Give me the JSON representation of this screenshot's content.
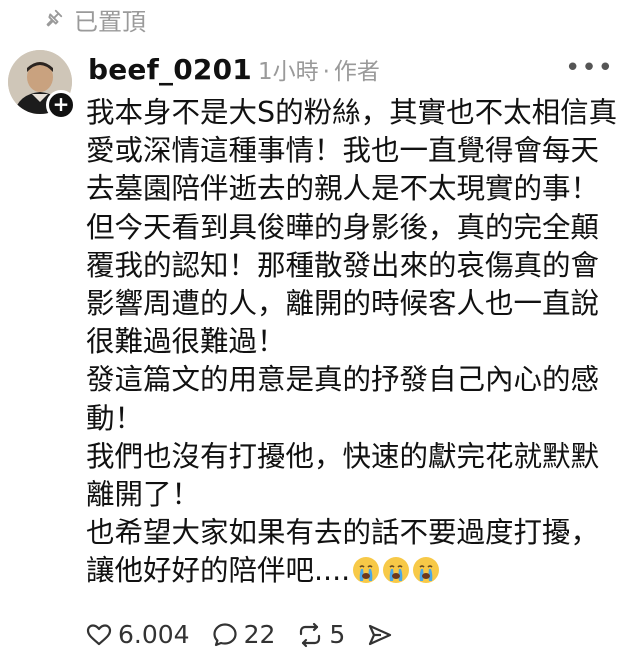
{
  "pinned": {
    "label": "已置頂",
    "icon": "pin-icon"
  },
  "post": {
    "username": "beef_0201",
    "timestamp": "1小時",
    "separator": "·",
    "author_tag": "作者",
    "more_icon": "more-horizontal-icon",
    "avatar_badge": "+",
    "paragraphs": [
      "我本身不是大S的粉絲，其實也不太相信真愛或深情這種事情！我也一直覺得會每天去墓園陪伴逝去的親人是不太現實的事！但今天看到具俊曄的身影後，真的完全顛覆我的認知！那種散發出來的哀傷真的會影響周遭的人，離開的時候客人也一直說很難過很難過！",
      "發這篇文的用意是真的抒發自己內心的感動！",
      "我們也沒有打擾他，快速的獻完花就默默離開了！",
      "也希望大家如果有去的話不要過度打擾，讓他好好的陪伴吧...."
    ],
    "trailing_emojis": [
      "crying-face-emoji",
      "crying-face-emoji",
      "crying-face-emoji"
    ]
  },
  "actions": {
    "likes": "6.004",
    "comments": "22",
    "reposts": "5",
    "like_icon": "heart-icon",
    "comment_icon": "comment-bubble-icon",
    "repost_icon": "repost-icon",
    "share_icon": "share-send-icon"
  },
  "colors": {
    "text": "#111111",
    "muted": "#9a9a9a",
    "background": "#ffffff"
  }
}
